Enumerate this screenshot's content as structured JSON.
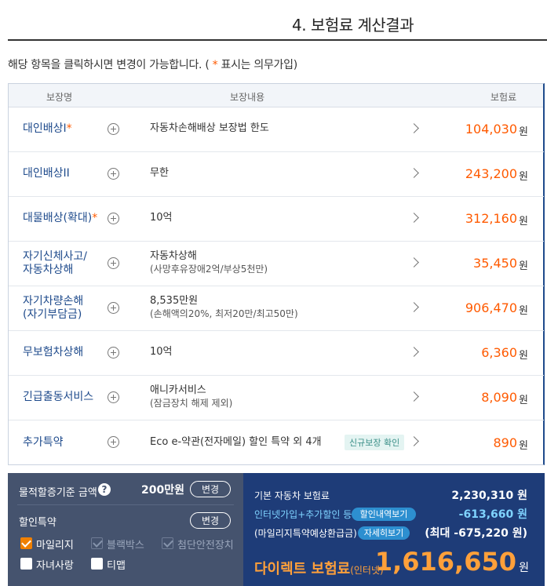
{
  "title": "4. 보험료 계산결과",
  "notice": {
    "before": "해당 항목을 클릭하시면 변경이 가능합니다. ( ",
    "star": "*",
    "after": " 표시는 의무가입)"
  },
  "table": {
    "headers": {
      "name": "보장명",
      "content": "보장내용",
      "premium": "보험료"
    },
    "currency": "원",
    "rows": [
      {
        "name_lines": [
          "대인배상I"
        ],
        "required": "*",
        "content": "자동차손해배상 보장법 한도",
        "content_sub": "",
        "amount": "104,030"
      },
      {
        "name_lines": [
          "대인배상II"
        ],
        "required": "",
        "content": "무한",
        "content_sub": "",
        "amount": "243,200"
      },
      {
        "name_lines": [
          "대물배상(확대)"
        ],
        "required": "*",
        "content": "10억",
        "content_sub": "",
        "amount": "312,160"
      },
      {
        "name_lines": [
          "자기신체사고/",
          "자동차상해"
        ],
        "required": "",
        "content": "자동차상해",
        "content_sub": "(사망후유장애2억/부상5천만)",
        "amount": "35,450"
      },
      {
        "name_lines": [
          "자기차량손해",
          "(자기부담금)"
        ],
        "required": "",
        "content": "8,535만원",
        "content_sub": "(손해액의20%, 최저20만/최고50만)",
        "amount": "906,470"
      },
      {
        "name_lines": [
          "무보험차상해"
        ],
        "required": "",
        "content": "10억",
        "content_sub": "",
        "amount": "6,360"
      },
      {
        "name_lines": [
          "긴급출동서비스"
        ],
        "required": "",
        "content": "애니카서비스",
        "content_sub": "(잠금장치 해제 제외)",
        "amount": "8,090"
      },
      {
        "name_lines": [
          "추가특약"
        ],
        "required": "",
        "content": "Eco e-약관(전자메일) 할인 특약 외 4개",
        "content_sub": "",
        "amount": "890",
        "badge": "신규보장 확인"
      }
    ]
  },
  "bottom_left": {
    "property_label": "물적할증기준 금액",
    "help_icon": "?",
    "property_value": "200만원",
    "change_label": "변경",
    "discount_label": "할인특약",
    "discount_change_label": "변경",
    "options": {
      "mileage": {
        "label": "마일리지",
        "state": "checked"
      },
      "blackbox": {
        "label": "블랙박스",
        "state": "disabled"
      },
      "safety": {
        "label": "첨단안전장치",
        "state": "disabled"
      },
      "child": {
        "label": "자녀사랑",
        "state": "unchecked"
      },
      "tmap": {
        "label": "티맵",
        "state": "unchecked"
      }
    }
  },
  "bottom_right": {
    "base_label": "기본 자동차 보험료",
    "base_value": "2,230,310 원",
    "discount_label": "인터넷가입+추가할인 등",
    "discount_pill": "할인내역보기",
    "discount_value": "-613,660 원",
    "mileage_label": "(마일리지특약예상환급금)",
    "mileage_pill": "자세히보기",
    "mileage_value": "(최대 -675,220 원)",
    "total_label": "다이렉트 보험료",
    "total_suffix": "(인터넷)",
    "total_value": "1,616,650",
    "total_won": "원"
  },
  "colors": {
    "accent_orange": "#ff5a00",
    "navy": "#1e3c78",
    "slate": "#45536e",
    "link_blue": "#1f4b8c"
  }
}
